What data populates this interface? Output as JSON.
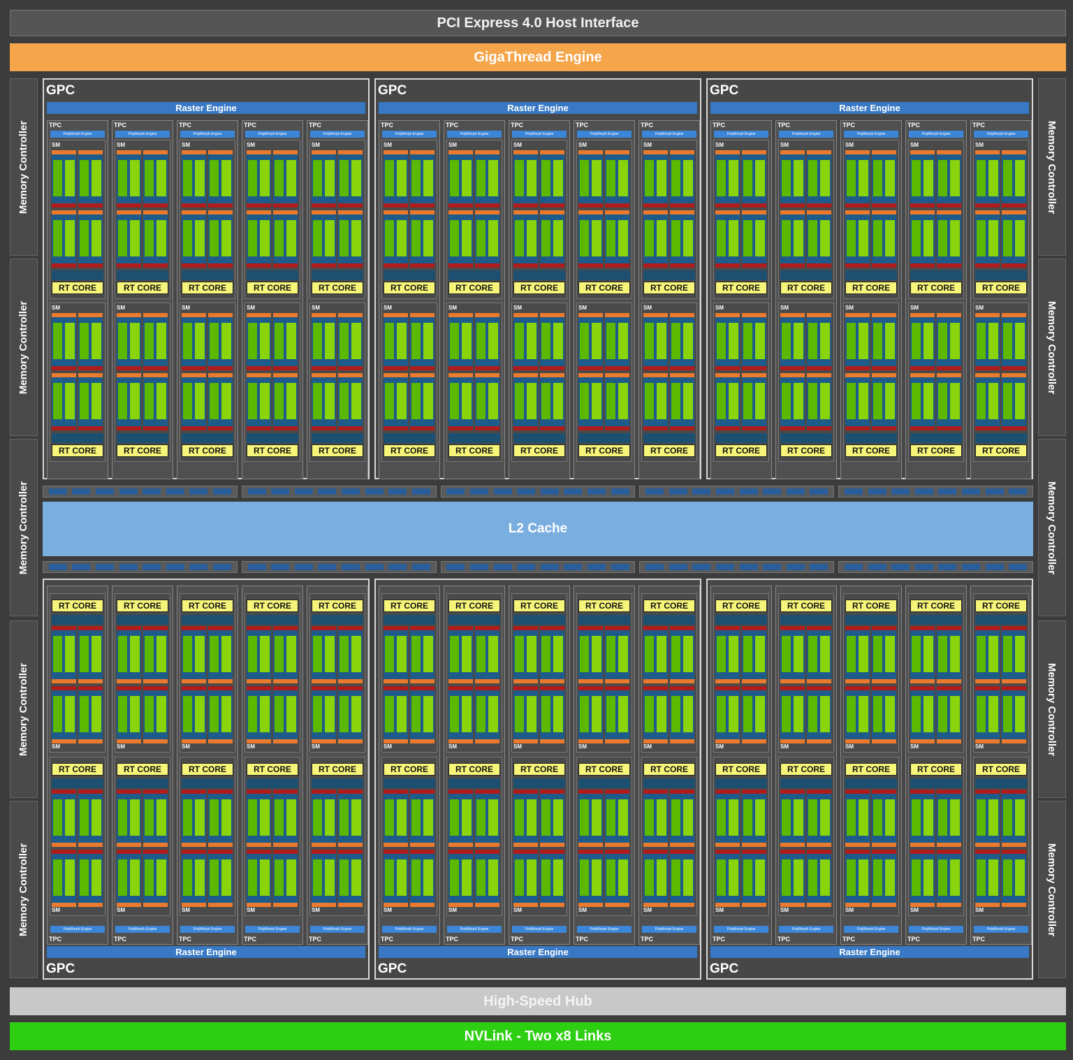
{
  "header": {
    "pcie": "PCI Express 4.0 Host Interface",
    "gigathread": "GigaThread Engine"
  },
  "footer": {
    "hub": "High-Speed Hub",
    "nvlink": "NVLink - Two x8 Links"
  },
  "memory_controller": "Memory Controller",
  "l2": "L2 Cache",
  "gpc": {
    "label": "GPC",
    "raster": "Raster Engine",
    "tpc": "TPC",
    "polymorph": "PolyMorph Engine",
    "sm": "SM",
    "rt_core": "RT CORE"
  },
  "colors": {
    "background": "#3c3c3c",
    "gigathread": "#f5a54a",
    "l2": "#7aaede",
    "nvlink": "#2ecf12",
    "hub": "#c8c8c8",
    "raster": "#3878c4",
    "rt_core": "#f6f57a",
    "core_green": "#5cb800"
  }
}
